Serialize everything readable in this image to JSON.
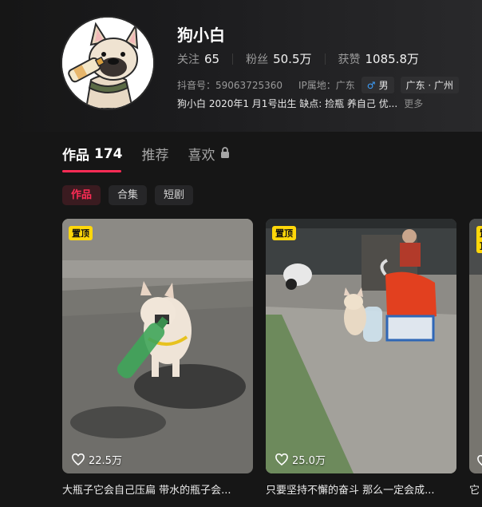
{
  "profile": {
    "name": "狗小白",
    "stats": [
      {
        "label": "关注",
        "value": "65"
      },
      {
        "label": "粉丝",
        "value": "50.5万"
      },
      {
        "label": "获赞",
        "value": "1085.8万"
      }
    ],
    "douyin_id_label": "抖音号：",
    "douyin_id": "59063725360",
    "ip_label": "IP属地：",
    "ip": "广东",
    "gender": "男",
    "region": "广东 · 广州",
    "bio": "狗小白 2020年1 月1号出生 缺点: 捡瓶 养自己 优...",
    "more": "更多"
  },
  "tabs": [
    {
      "label": "作品",
      "count": "174"
    },
    {
      "label": "推荐"
    },
    {
      "label": "喜欢"
    }
  ],
  "chips": [
    "作品",
    "合集",
    "短剧"
  ],
  "videos": [
    {
      "pin": "置顶",
      "likes": "22.5万",
      "caption": "大瓶子它会自己压扁 带水的瓶子会..."
    },
    {
      "pin": "置顶",
      "likes": "25.0万",
      "caption": "只要坚持不懈的奋斗 那么一定会成..."
    },
    {
      "pin": "置顶",
      "likes": "",
      "caption": "它"
    }
  ]
}
